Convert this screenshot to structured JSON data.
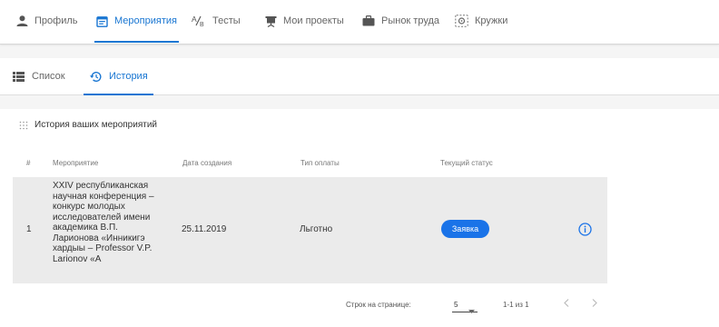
{
  "top_nav": {
    "items": [
      {
        "label": "Профиль",
        "icon": "person-icon"
      },
      {
        "label": "Мероприятия",
        "icon": "calendar-icon",
        "active": true
      },
      {
        "label": "Тесты",
        "icon": "ab-icon"
      },
      {
        "label": "Мои проекты",
        "icon": "presentation-icon"
      },
      {
        "label": "Рынок труда",
        "icon": "briefcase-icon"
      },
      {
        "label": "Кружки",
        "icon": "circles-icon"
      }
    ]
  },
  "sub_nav": {
    "items": [
      {
        "label": "Список",
        "icon": "list-icon"
      },
      {
        "label": "История",
        "icon": "history-icon",
        "active": true
      }
    ]
  },
  "section": {
    "title": "История ваших мероприятий",
    "icon": "grid-dots-icon"
  },
  "table": {
    "headers": [
      "#",
      "Мероприятие",
      "Дата создания",
      "Тип оплаты",
      "Текущий статус"
    ],
    "rows": [
      {
        "num": "1",
        "event_lines": [
          "XXIV республиканская",
          "научная конференция –",
          "конкурс молодых",
          "исследователей имени",
          "академика В.П.",
          "Ларионова «Инникигэ",
          "хардыы – Professor V.P.",
          "Larionov «A"
        ],
        "date": "25.11.2019",
        "payment": "Льготно",
        "status": "Заявка",
        "info_icon": "info-icon"
      }
    ]
  },
  "pagination": {
    "rows_per_page_label": "Строк на странице:",
    "rows_per_page_value": "5",
    "range": "1-1 из 1",
    "prev_icon": "chevron-left-icon",
    "next_icon": "chevron-right-icon"
  },
  "colors": {
    "accent": "#1976d2",
    "badge": "#1a73e8",
    "row_bg": "#ebebeb"
  }
}
